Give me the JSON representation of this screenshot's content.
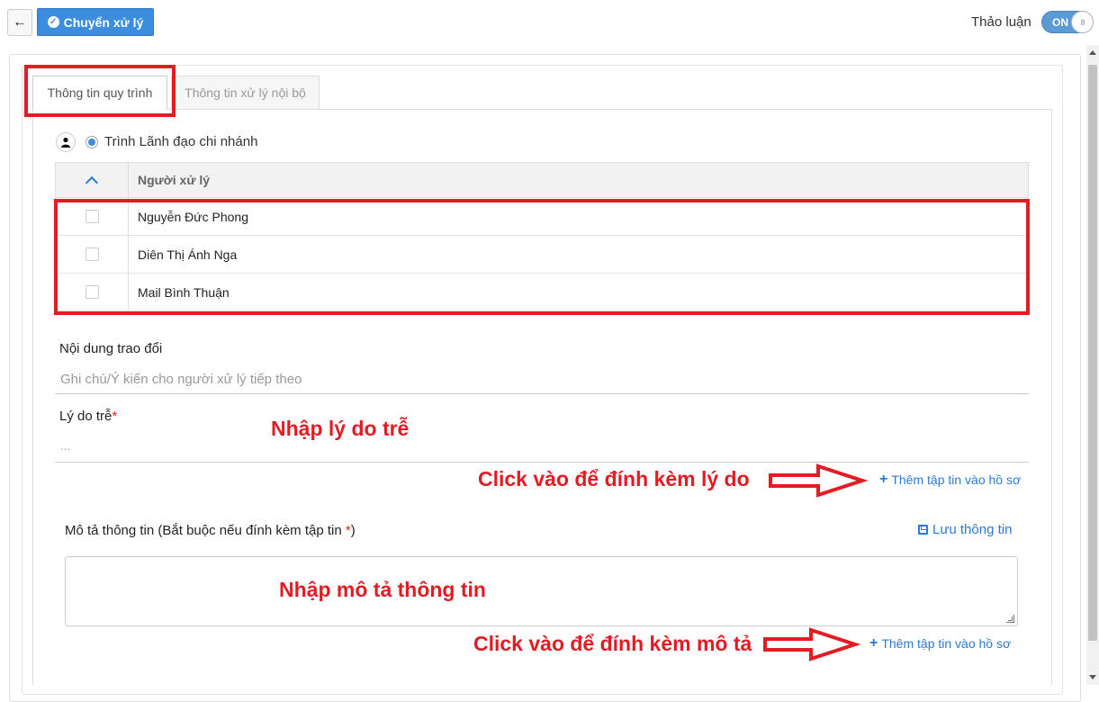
{
  "toolbar": {
    "back_icon": "arrow-left-icon",
    "process_label": "Chuyển xử lý",
    "discuss_label": "Thảo luận",
    "toggle_state": "ON",
    "toggle_knob_glyph": "III"
  },
  "tabs": [
    {
      "label": "Thông tin quy trình",
      "active": true
    },
    {
      "label": "Thông tin xử lý nội bộ",
      "active": false
    }
  ],
  "radio": {
    "label": "Trình Lãnh đạo chi nhánh",
    "selected": true
  },
  "table": {
    "header": "Người xử lý",
    "rows": [
      {
        "name": "Nguyễn Đức Phong",
        "checked": false
      },
      {
        "name": "Diên Thị Ánh Nga",
        "checked": false
      },
      {
        "name": "Mail Bình Thuận",
        "checked": false
      }
    ]
  },
  "form": {
    "content_label": "Nội dung trao đổi",
    "content_placeholder": "Ghi chú/Ý kiến cho người xử lý tiếp theo",
    "delay_label": "Lý do trễ",
    "required_mark": "*",
    "delay_placeholder": "...",
    "attach_link": "Thêm tập tin vào hồ sơ",
    "desc_label": "Mô tả thông tin (Bắt buộc nếu đính kèm tập tin ",
    "desc_label_end": ")",
    "save_link": "Lưu thông tin"
  },
  "annotations": {
    "enter_delay": "Nhập lý do trễ",
    "click_attach_reason": "Click vào để đính kèm lý do",
    "enter_desc": "Nhập mô tả thông tin",
    "click_attach_desc": "Click vào để đính kèm mô tả"
  },
  "colors": {
    "accent": "#3c8ddd",
    "annotation_red": "#e31c24",
    "link": "#2a7ad4"
  }
}
